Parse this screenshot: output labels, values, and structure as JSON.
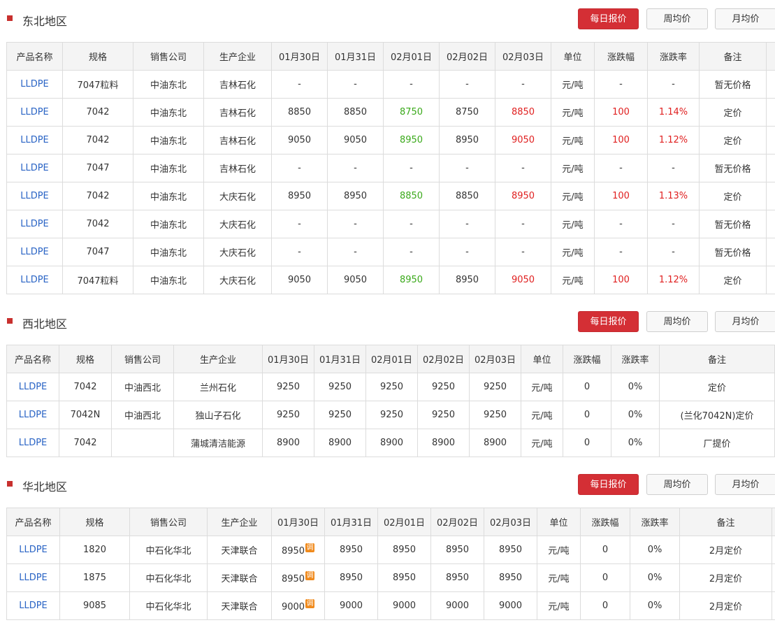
{
  "buttons": {
    "daily": "每日报价",
    "weekly": "周均价",
    "monthly": "月均价"
  },
  "adjust_badge": "调",
  "colors": {
    "primary": "#d42f35",
    "link": "#2a64c5",
    "up": "#e02020",
    "down": "#3aa91a",
    "badge": "#f08a1c"
  },
  "sections": [
    {
      "title": "东北地区",
      "headers": [
        "产品名称",
        "规格",
        "销售公司",
        "生产企业",
        "01月30日",
        "01月31日",
        "02月01日",
        "02月02日",
        "02月03日",
        "单位",
        "涨跌幅",
        "涨跌率",
        "备注"
      ],
      "rows": [
        [
          "LLDPE",
          "7047粒料",
          "中油东北",
          "吉林石化",
          "-",
          "-",
          "-",
          "-",
          "-",
          "元/吨",
          "-",
          "-",
          "暂无价格"
        ],
        [
          "LLDPE",
          "7042",
          "中油东北",
          "吉林石化",
          "8850",
          "8850",
          "8750",
          "8750",
          "8850",
          "元/吨",
          "100",
          "1.14%",
          "定价"
        ],
        [
          "LLDPE",
          "7042",
          "中油东北",
          "吉林石化",
          "9050",
          "9050",
          "8950",
          "8950",
          "9050",
          "元/吨",
          "100",
          "1.12%",
          "定价"
        ],
        [
          "LLDPE",
          "7047",
          "中油东北",
          "吉林石化",
          "-",
          "-",
          "-",
          "-",
          "-",
          "元/吨",
          "-",
          "-",
          "暂无价格"
        ],
        [
          "LLDPE",
          "7042",
          "中油东北",
          "大庆石化",
          "8950",
          "8950",
          "8850",
          "8850",
          "8950",
          "元/吨",
          "100",
          "1.13%",
          "定价"
        ],
        [
          "LLDPE",
          "7042",
          "中油东北",
          "大庆石化",
          "-",
          "-",
          "-",
          "-",
          "-",
          "元/吨",
          "-",
          "-",
          "暂无价格"
        ],
        [
          "LLDPE",
          "7047",
          "中油东北",
          "大庆石化",
          "-",
          "-",
          "-",
          "-",
          "-",
          "元/吨",
          "-",
          "-",
          "暂无价格"
        ],
        [
          "LLDPE",
          "7047粒料",
          "中油东北",
          "大庆石化",
          "9050",
          "9050",
          "8950",
          "8950",
          "9050",
          "元/吨",
          "100",
          "1.12%",
          "定价"
        ]
      ]
    },
    {
      "title": "西北地区",
      "headers": [
        "产品名称",
        "规格",
        "销售公司",
        "生产企业",
        "01月30日",
        "01月31日",
        "02月01日",
        "02月02日",
        "02月03日",
        "单位",
        "涨跌幅",
        "涨跌率",
        "备注"
      ],
      "rows": [
        [
          "LLDPE",
          "7042",
          "中油西北",
          "兰州石化",
          "9250",
          "9250",
          "9250",
          "9250",
          "9250",
          "元/吨",
          "0",
          "0%",
          "定价"
        ],
        [
          "LLDPE",
          "7042N",
          "中油西北",
          "独山子石化",
          "9250",
          "9250",
          "9250",
          "9250",
          "9250",
          "元/吨",
          "0",
          "0%",
          "(兰化7042N)定价"
        ],
        [
          "LLDPE",
          "7042",
          "",
          "蒲城清洁能源",
          "8900",
          "8900",
          "8900",
          "8900",
          "8900",
          "元/吨",
          "0",
          "0%",
          "厂提价"
        ]
      ]
    },
    {
      "title": "华北地区",
      "headers": [
        "产品名称",
        "规格",
        "销售公司",
        "生产企业",
        "01月30日",
        "01月31日",
        "02月01日",
        "02月02日",
        "02月03日",
        "单位",
        "涨跌幅",
        "涨跌率",
        "备注"
      ],
      "rows": [
        [
          "LLDPE",
          "1820",
          "中石化华北",
          "天津联合",
          "8950",
          "8950",
          "8950",
          "8950",
          "8950",
          "元/吨",
          "0",
          "0%",
          "2月定价"
        ],
        [
          "LLDPE",
          "1875",
          "中石化华北",
          "天津联合",
          "8950",
          "8950",
          "8950",
          "8950",
          "8950",
          "元/吨",
          "0",
          "0%",
          "2月定价"
        ],
        [
          "LLDPE",
          "9085",
          "中石化华北",
          "天津联合",
          "9000",
          "9000",
          "9000",
          "9000",
          "9000",
          "元/吨",
          "0",
          "0%",
          "2月定价"
        ]
      ]
    }
  ]
}
